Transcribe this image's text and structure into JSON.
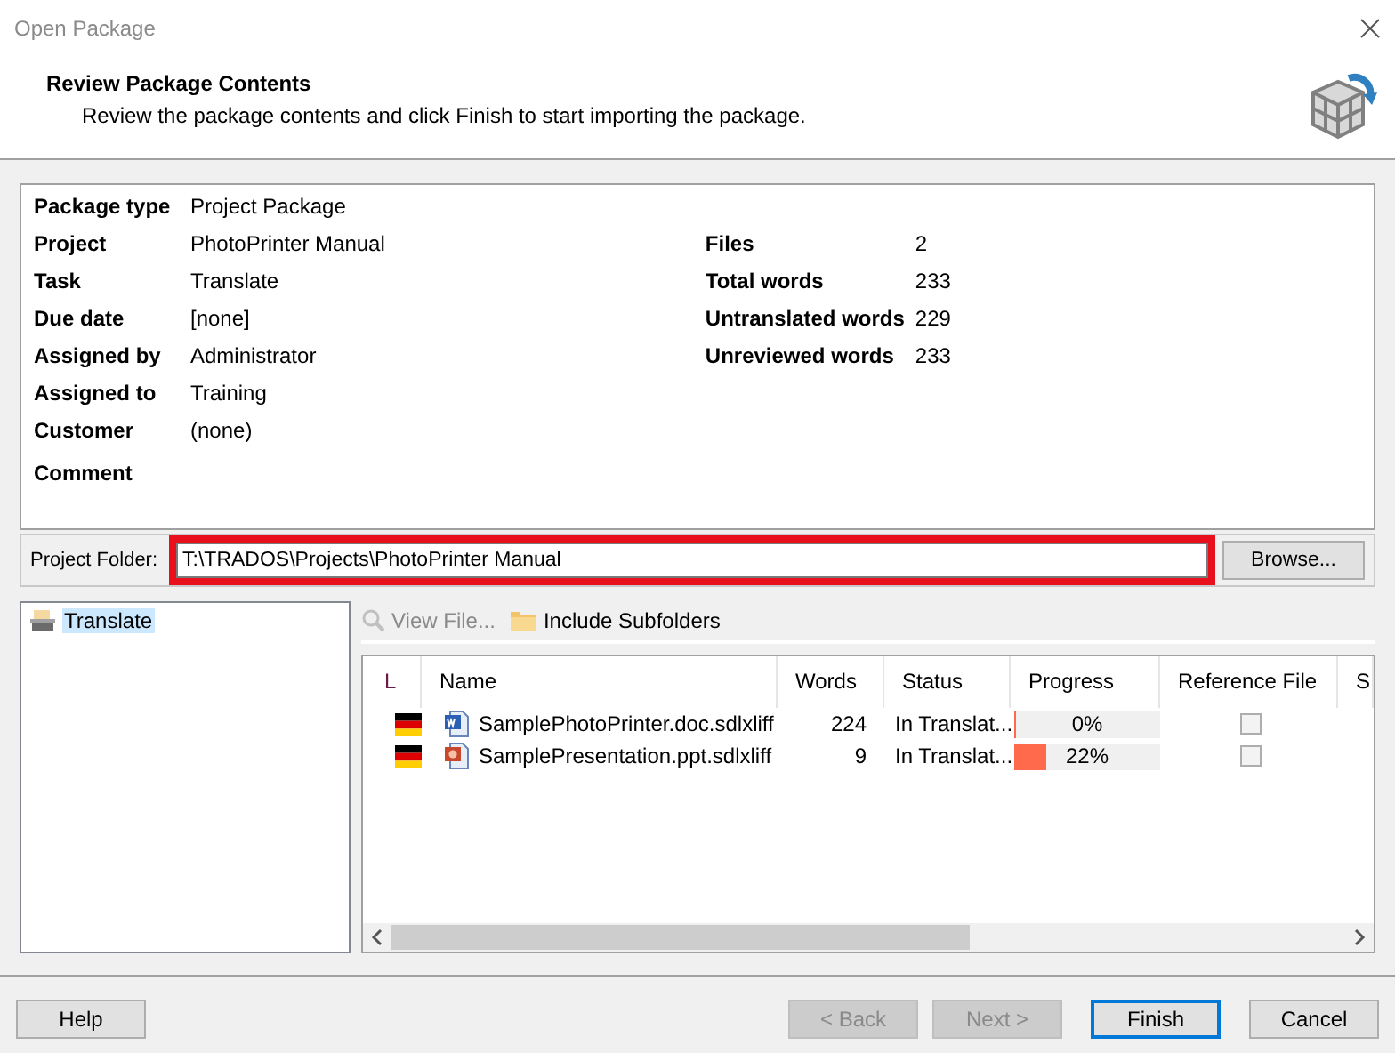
{
  "window": {
    "title": "Open Package"
  },
  "header": {
    "title": "Review Package Contents",
    "subtitle": "Review the package contents and click Finish to start importing the package."
  },
  "details_left": [
    {
      "label": "Package type",
      "value": "Project Package"
    },
    {
      "label": "Project",
      "value": "PhotoPrinter Manual"
    },
    {
      "label": "Task",
      "value": "Translate"
    },
    {
      "label": "Due date",
      "value": "[none]"
    },
    {
      "label": "Assigned by",
      "value": "Administrator"
    },
    {
      "label": "Assigned to",
      "value": "Training"
    },
    {
      "label": "Customer",
      "value": "(none)"
    },
    {
      "label": "Comment"
    }
  ],
  "details_right": [
    {
      "label": "Files",
      "value": "2"
    },
    {
      "label": "Total words",
      "value": "233"
    },
    {
      "label": "Untranslated words",
      "value": "229"
    },
    {
      "label": "Unreviewed words",
      "value": "233"
    }
  ],
  "project_folder": {
    "label": "Project Folder:",
    "value": "T:\\TRADOS\\Projects\\PhotoPrinter Manual",
    "highlighted": true,
    "browse": "Browse..."
  },
  "tree": {
    "items": [
      {
        "label": "Translate",
        "selected": true
      }
    ]
  },
  "toolbar": [
    {
      "label": "View File...",
      "kind": "view",
      "disabled": true
    },
    {
      "label": "Include Subfolders",
      "kind": "folder",
      "disabled": false
    }
  ],
  "table": {
    "columns": [
      "L",
      "Name",
      "Words",
      "Status",
      "Progress",
      "Reference File",
      "S"
    ],
    "rows": [
      {
        "kind": "word",
        "name": "SamplePhotoPrinter.doc.sdlxliff",
        "words": "224",
        "status": "In Translat...",
        "level": 0,
        "progress": "0%",
        "checked": false
      },
      {
        "kind": "powerpoint",
        "name": "SamplePresentation.ppt.sdlxliff",
        "words": "9",
        "status": "In Translat...",
        "level": 0.22,
        "progress": "22%",
        "checked": false
      }
    ]
  },
  "buttons": [
    {
      "label": "Help",
      "disabled": false,
      "default": false
    },
    {
      "label": "< Back",
      "disabled": true,
      "default": false
    },
    {
      "label": "Next >",
      "disabled": true,
      "default": false
    },
    {
      "label": "Finish",
      "disabled": false,
      "default": true
    },
    {
      "label": "Cancel",
      "disabled": false,
      "default": false
    }
  ]
}
